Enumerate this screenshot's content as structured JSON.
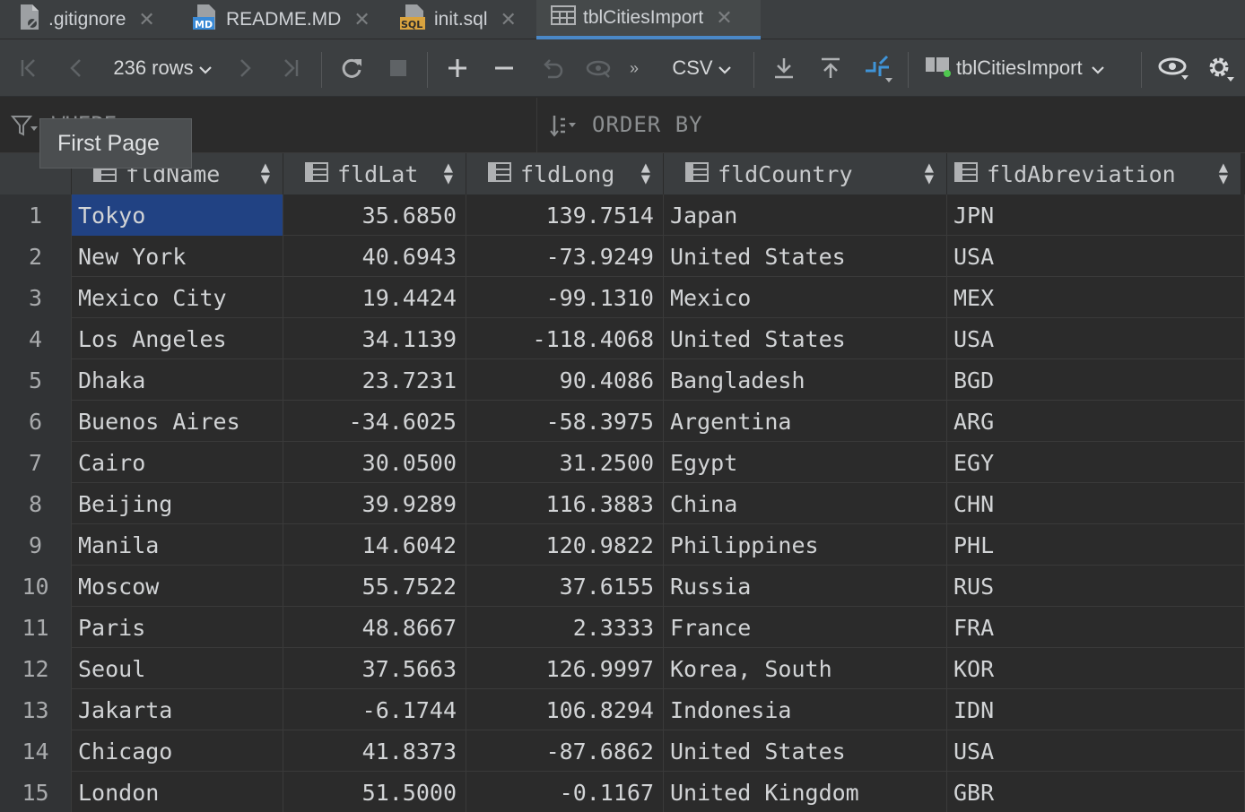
{
  "tabs": [
    {
      "label": ".gitignore",
      "icon": "gitignore-file-icon"
    },
    {
      "label": "README.MD",
      "icon": "markdown-file-icon"
    },
    {
      "label": "init.sql",
      "icon": "sql-file-icon"
    },
    {
      "label": "tblCitiesImport",
      "icon": "table-icon"
    }
  ],
  "toolbar": {
    "rows_label": "236 rows",
    "format_label": "CSV",
    "table_selector_label": "tblCitiesImport"
  },
  "filter": {
    "where_label": "WHERE",
    "order_by_label": "ORDER BY"
  },
  "tooltip": {
    "text": "First Page"
  },
  "columns": [
    "fldName",
    "fldLat",
    "fldLong",
    "fldCountry",
    "fldAbreviation"
  ],
  "rows": [
    {
      "n": "1",
      "name": "Tokyo",
      "lat": "35.6850",
      "long": "139.7514",
      "country": "Japan",
      "abbr": "JPN"
    },
    {
      "n": "2",
      "name": "New York",
      "lat": "40.6943",
      "long": "-73.9249",
      "country": "United States",
      "abbr": "USA"
    },
    {
      "n": "3",
      "name": "Mexico City",
      "lat": "19.4424",
      "long": "-99.1310",
      "country": "Mexico",
      "abbr": "MEX"
    },
    {
      "n": "4",
      "name": "Los Angeles",
      "lat": "34.1139",
      "long": "-118.4068",
      "country": "United States",
      "abbr": "USA"
    },
    {
      "n": "5",
      "name": "Dhaka",
      "lat": "23.7231",
      "long": "90.4086",
      "country": "Bangladesh",
      "abbr": "BGD"
    },
    {
      "n": "6",
      "name": "Buenos Aires",
      "lat": "-34.6025",
      "long": "-58.3975",
      "country": "Argentina",
      "abbr": "ARG"
    },
    {
      "n": "7",
      "name": "Cairo",
      "lat": "30.0500",
      "long": "31.2500",
      "country": "Egypt",
      "abbr": "EGY"
    },
    {
      "n": "8",
      "name": "Beijing",
      "lat": "39.9289",
      "long": "116.3883",
      "country": "China",
      "abbr": "CHN"
    },
    {
      "n": "9",
      "name": "Manila",
      "lat": "14.6042",
      "long": "120.9822",
      "country": "Philippines",
      "abbr": "PHL"
    },
    {
      "n": "10",
      "name": "Moscow",
      "lat": "55.7522",
      "long": "37.6155",
      "country": "Russia",
      "abbr": "RUS"
    },
    {
      "n": "11",
      "name": "Paris",
      "lat": "48.8667",
      "long": "2.3333",
      "country": "France",
      "abbr": "FRA"
    },
    {
      "n": "12",
      "name": "Seoul",
      "lat": "37.5663",
      "long": "126.9997",
      "country": "Korea, South",
      "abbr": "KOR"
    },
    {
      "n": "13",
      "name": "Jakarta",
      "lat": "-6.1744",
      "long": "106.8294",
      "country": "Indonesia",
      "abbr": "IDN"
    },
    {
      "n": "14",
      "name": "Chicago",
      "lat": "41.8373",
      "long": "-87.6862",
      "country": "United States",
      "abbr": "USA"
    },
    {
      "n": "15",
      "name": "London",
      "lat": "51.5000",
      "long": "-0.1167",
      "country": "United Kingdom",
      "abbr": "GBR"
    }
  ],
  "colors": {
    "selection": "#214283",
    "accent": "#4a88c7",
    "background": "#2b2b2b"
  }
}
